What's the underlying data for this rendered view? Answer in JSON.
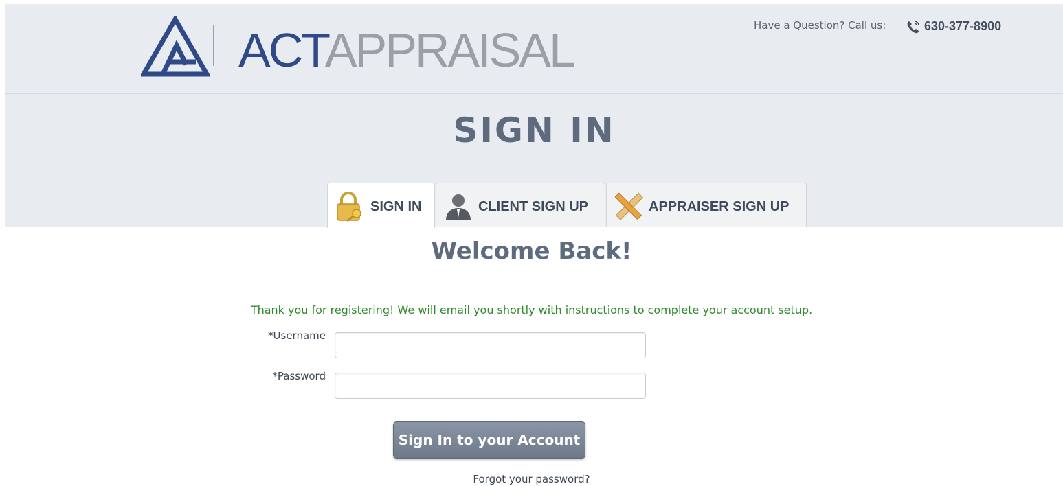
{
  "header": {
    "logo_text_primary": "ACT",
    "logo_text_secondary": "APPRAISAL",
    "question_text": "Have a Question? Call us:",
    "phone_number": "630-377-8900",
    "phone_icon": "phone-icon"
  },
  "page_title": "SIGN IN",
  "tabs": [
    {
      "label": "SIGN IN",
      "icon": "padlock-key-icon",
      "active": true
    },
    {
      "label": "CLIENT SIGN UP",
      "icon": "person-icon",
      "active": false
    },
    {
      "label": "APPRAISER SIGN UP",
      "icon": "pencil-ruler-icon",
      "active": false
    }
  ],
  "form": {
    "welcome_heading": "Welcome Back!",
    "success_message": "Thank you for registering! We will email you shortly with instructions to complete your account setup.",
    "username_label": "*Username",
    "username_value": "",
    "password_label": "*Password",
    "password_value": "",
    "submit_label": "Sign In to your Account",
    "forgot_password_link": "Forgot your password?"
  },
  "colors": {
    "brand_navy": "#2f4a87",
    "brand_gray": "#9aa0a8",
    "band_background": "#e8ecf0",
    "success_green": "#2e8a2a",
    "button_slate": "#7a8596"
  }
}
